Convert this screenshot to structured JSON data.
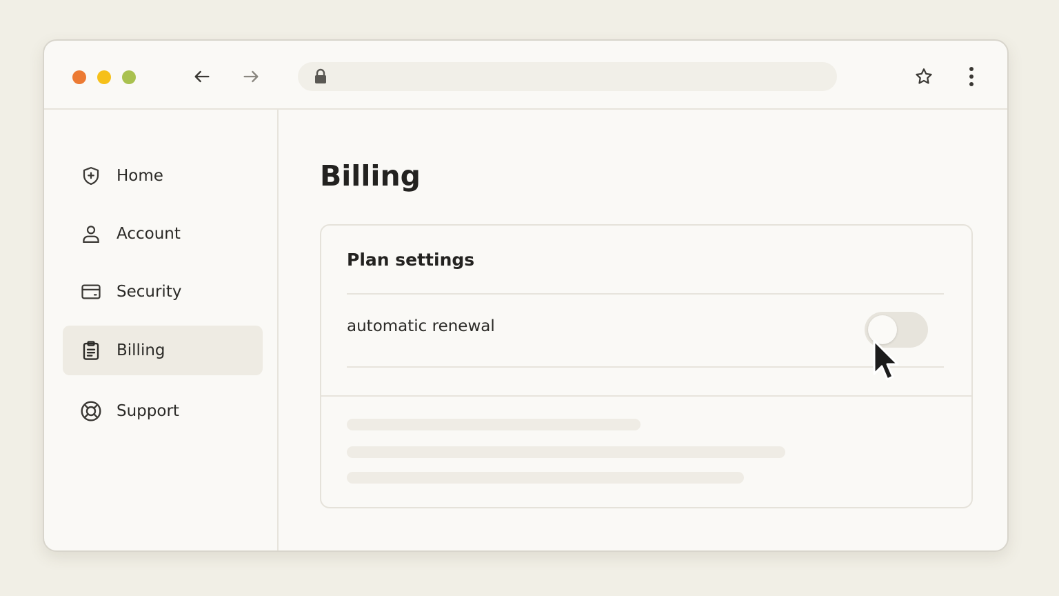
{
  "browser": {
    "back_icon": "arrow-left-icon",
    "forward_icon": "arrow-right-icon",
    "lock_icon": "lock-icon",
    "address": "",
    "bookmark_icon": "star-icon",
    "menu_icon": "more-vertical-icon"
  },
  "sidebar": {
    "items": [
      {
        "label": "Home",
        "icon": "shield-plus-icon",
        "active": false
      },
      {
        "label": "Account",
        "icon": "user-icon",
        "active": false
      },
      {
        "label": "Security",
        "icon": "credit-card-icon",
        "active": false
      },
      {
        "label": "Billing",
        "icon": "clipboard-icon",
        "active": true
      },
      {
        "label": "Support",
        "icon": "lifebuoy-icon",
        "active": false
      }
    ]
  },
  "main": {
    "title": "Billing",
    "card": {
      "title": "Plan settings",
      "setting": {
        "label": "automatic renewal",
        "enabled": false
      }
    }
  },
  "colors": {
    "background": "#f1efe6",
    "window": "#faf9f6",
    "traffic_red": "#ec7a33",
    "traffic_yellow": "#f6c019",
    "traffic_green": "#a9c14f",
    "active_nav": "#eeebe3",
    "toggle_off": "#e7e4dc"
  }
}
